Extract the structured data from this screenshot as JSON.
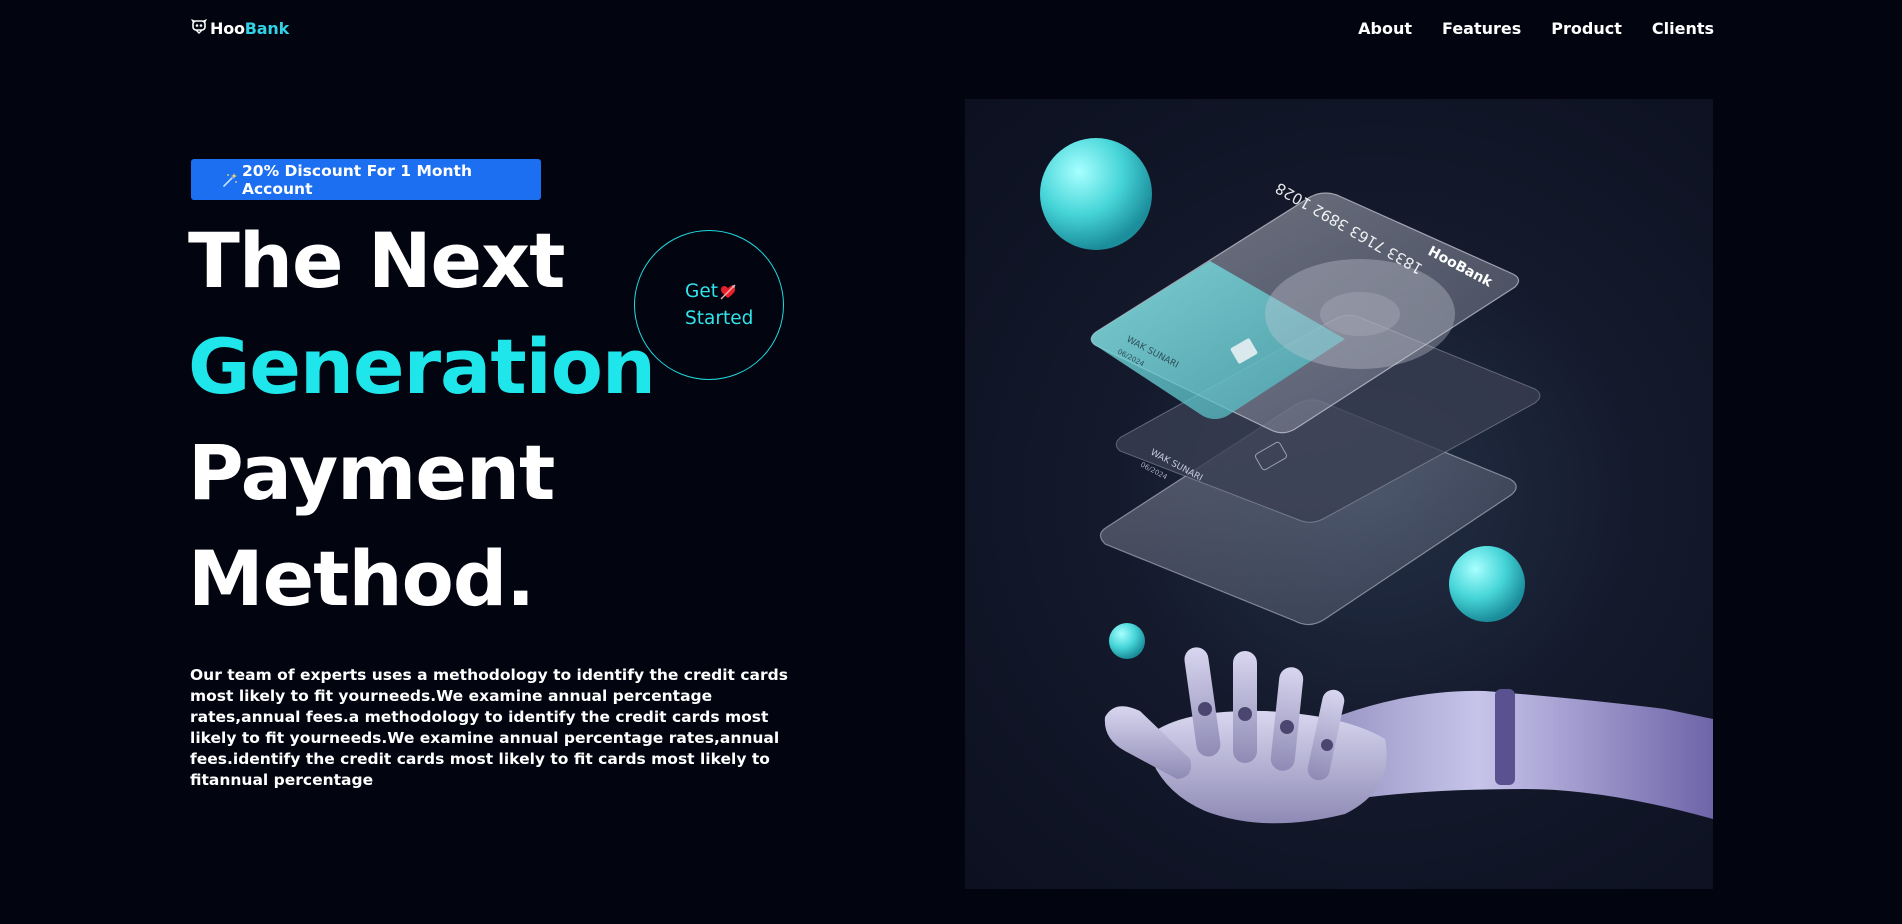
{
  "brand": {
    "name_part1": "Hoo",
    "name_part2": "Bank",
    "logo_icon": "robot-head-icon"
  },
  "nav": {
    "items": [
      {
        "label": "About"
      },
      {
        "label": "Features"
      },
      {
        "label": "Product"
      },
      {
        "label": "Clients"
      }
    ]
  },
  "hero": {
    "badge": {
      "icon": "magic-wand-icon",
      "text": "20% Discount For 1 Month Account"
    },
    "headline": {
      "line1": "The Next",
      "line2": "Generation",
      "line3": "Payment",
      "line4": "Method."
    },
    "cta": {
      "line1": "Get",
      "line2": "Started",
      "icon": "arrow-heart-icon"
    },
    "description": "Our team of experts uses a methodology to identify the credit cards most likely to fit yourneeds.We examine annual percentage rates,annual fees.a methodology to identify the credit cards most likely to fit yourneeds.We examine annual percentage rates,annual fees.identify the credit cards most likely to fit cards most likely to fitannual percentage",
    "image": {
      "card_number": "1833 7163 3892 1028",
      "card_brand": "HooBank",
      "card_holder": "WAK SUNARI",
      "card_expiry": "06/2024"
    }
  },
  "colors": {
    "background": "#02040f",
    "accent": "#1fe6ea",
    "badge_bg": "#1d6ff2",
    "text": "#ffffff"
  }
}
